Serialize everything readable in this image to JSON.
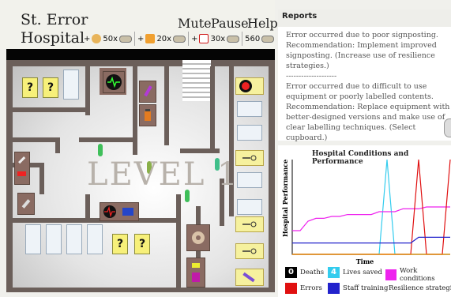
{
  "header": {
    "title_line1": "St. Error",
    "title_line2": "Hospital",
    "mute_label": "Mute",
    "pause_label": "Pause",
    "help_label": "Help"
  },
  "toolbar": {
    "items": [
      {
        "label": "+",
        "cost": "50x",
        "icon": "face-icon",
        "color": "#e8b45a"
      },
      {
        "label": "+",
        "cost": "20x",
        "icon": "thumbs-up-icon",
        "color": "#f0a030"
      },
      {
        "label": "+",
        "cost": "30x",
        "icon": "checkbox-icon",
        "color": "#d01818"
      }
    ],
    "money": "560"
  },
  "map": {
    "level_label": "LEVEL 1",
    "question_mark": "?"
  },
  "reports": {
    "title": "Reports",
    "entries": [
      "Error occurred due to poor signposting.",
      "Recommendation: Implement improved signposting. (Increase use of resilience strategies.)",
      "--------------------",
      "Error occurred due to difficult to use equipment or poorly labelled contents.",
      "Recommendation: Replace equipment with better-designed versions and make use of clear labelling techniques. (Select cupboard.)"
    ]
  },
  "chart_data": {
    "type": "line",
    "title": "Hospital Conditions and Performance",
    "xlabel": "Time",
    "ylabel": "Hospital Performance",
    "x": [
      0,
      5,
      10,
      15,
      20,
      25,
      30,
      35,
      40,
      45,
      50,
      55,
      60,
      65,
      70,
      75,
      80,
      85,
      90,
      95,
      100
    ],
    "ylim": [
      0,
      100
    ],
    "series": [
      {
        "name": "Deaths",
        "color": "#000000",
        "values": [
          0,
          0,
          0,
          0,
          0,
          0,
          0,
          0,
          0,
          0,
          0,
          0,
          0,
          0,
          0,
          0,
          0,
          0,
          0,
          0,
          0
        ]
      },
      {
        "name": "Lives saved",
        "color": "#33ccee",
        "values": [
          0,
          0,
          0,
          0,
          0,
          0,
          0,
          0,
          0,
          0,
          0,
          0,
          100,
          0,
          0,
          0,
          0,
          0,
          0,
          0,
          0
        ]
      },
      {
        "name": "Work conditions",
        "color": "#ee22ee",
        "values": [
          25,
          25,
          35,
          38,
          38,
          40,
          40,
          42,
          42,
          42,
          42,
          45,
          45,
          45,
          48,
          48,
          48,
          50,
          50,
          50,
          50
        ]
      },
      {
        "name": "Errors",
        "color": "#e01010",
        "values": [
          0,
          0,
          0,
          0,
          0,
          0,
          0,
          0,
          0,
          0,
          0,
          0,
          0,
          0,
          0,
          0,
          100,
          0,
          0,
          0,
          100
        ]
      },
      {
        "name": "Staff training",
        "color": "#2222cc",
        "values": [
          12,
          12,
          12,
          12,
          12,
          12,
          12,
          12,
          12,
          12,
          12,
          12,
          12,
          12,
          12,
          12,
          18,
          18,
          18,
          18,
          18
        ]
      },
      {
        "name": "Resilience strategies",
        "color": "#ff9900",
        "values": [
          0,
          0,
          0,
          0,
          0,
          0,
          0,
          0,
          0,
          0,
          0,
          0,
          0,
          0,
          0,
          0,
          0,
          0,
          0,
          0,
          0
        ]
      }
    ],
    "legend": {
      "deaths_count": "0",
      "lives_count": "4",
      "labels": [
        "Deaths",
        "Lives saved",
        "Work conditions",
        "Errors",
        "Staff training",
        "Resilience strategie"
      ]
    }
  }
}
